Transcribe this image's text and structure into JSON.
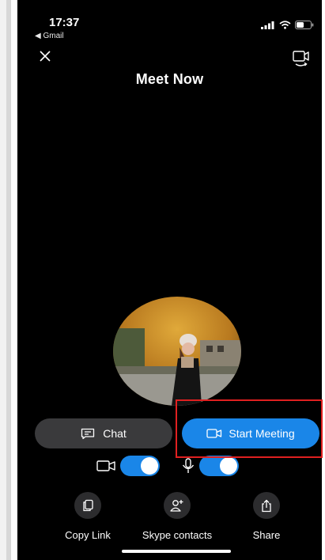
{
  "status_bar": {
    "time": "17:37",
    "back_app": "◀ Gmail"
  },
  "header": {
    "title": "Meet Now"
  },
  "buttons": {
    "chat_label": "Chat",
    "start_meeting_label": "Start Meeting"
  },
  "toggles": {
    "camera_on": true,
    "mic_on": true
  },
  "actions": [
    {
      "label": "Copy Link",
      "icon": "copy-icon"
    },
    {
      "label": "Skype contacts",
      "icon": "add-contact-icon"
    },
    {
      "label": "Share",
      "icon": "share-icon"
    }
  ],
  "colors": {
    "accent": "#1a86e8",
    "highlight_box": "#e02020",
    "background": "#000000"
  }
}
